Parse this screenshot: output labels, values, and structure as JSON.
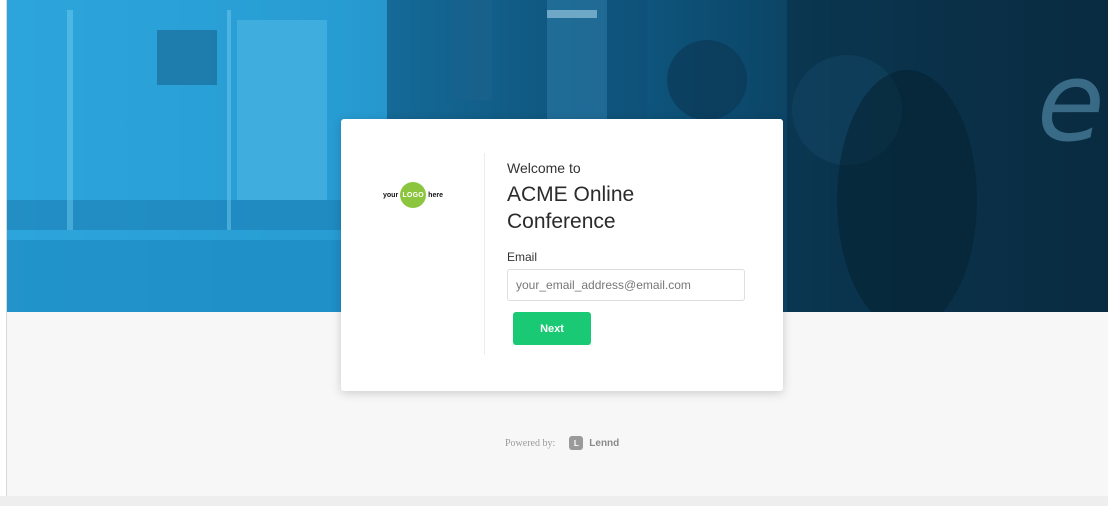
{
  "login": {
    "welcome": "Welcome to",
    "title": "ACME Online Conference",
    "email_label": "Email",
    "email_value": "",
    "email_placeholder": "your_email_address@email.com",
    "next_label": "Next"
  },
  "logo": {
    "left_text": "your",
    "center_text": "LOGO",
    "right_text": "here"
  },
  "footer": {
    "powered_by": "Powered by:",
    "brand_mark": "L",
    "brand_name": "Lennd"
  },
  "colors": {
    "accent_button": "#19c974",
    "logo_circle": "#8cc63f",
    "hero_blue": "#1e8fc6"
  },
  "icons": {
    "lennd": "lennd-logo-icon"
  }
}
